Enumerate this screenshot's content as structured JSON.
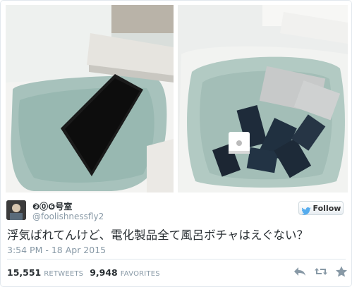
{
  "colors": {
    "text": "#292f33",
    "muted": "#8899a6",
    "twitter_blue": "#55acee",
    "divider": "#e1e8ed"
  },
  "photos": [
    {
      "subject": "laptop-in-bathtub-photo"
    },
    {
      "subject": "devices-in-bathtub-photo"
    }
  ],
  "author": {
    "display_name": "❸⓪❻号室",
    "screen_name": "@foolishnessfly2",
    "avatar_icon": "avatar-image"
  },
  "follow_button": {
    "label": "Follow",
    "icon": "twitter-bird-icon"
  },
  "tweet": {
    "text": "浮気ばれてんけど、電化製品全て風呂ボチャはえぐない？",
    "timestamp": "3:54 PM - 18 Apr 2015"
  },
  "stats": {
    "retweets_count": "15,551",
    "retweets_label": "RETWEETS",
    "favorites_count": "9,948",
    "favorites_label": "FAVORITES"
  },
  "actions": [
    {
      "icon": "reply-icon"
    },
    {
      "icon": "retweet-icon"
    },
    {
      "icon": "favorite-star-icon"
    }
  ]
}
